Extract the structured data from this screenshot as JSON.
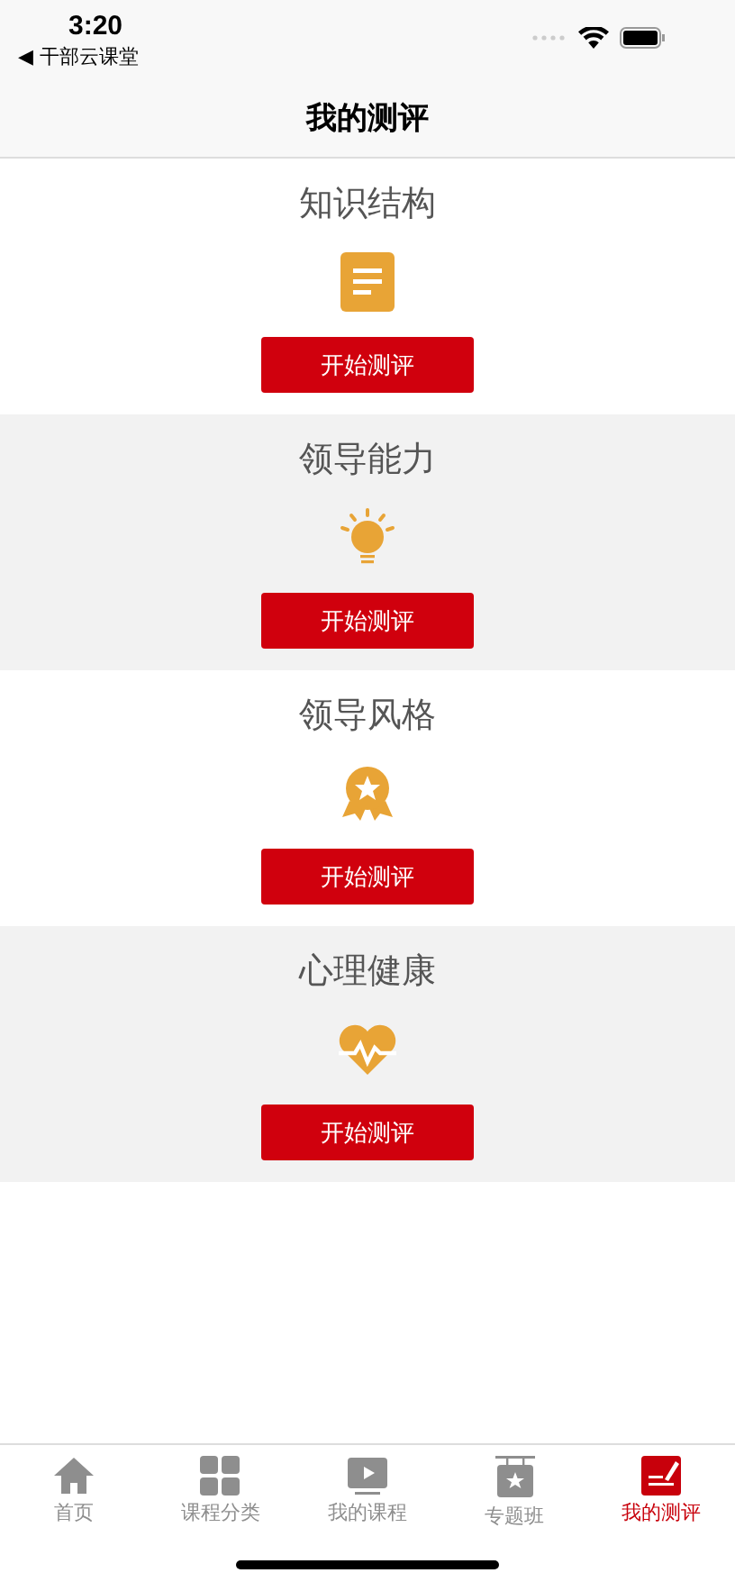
{
  "status_bar": {
    "time": "3:20",
    "back_app": "◀ 干部云课堂"
  },
  "header": {
    "title": "我的测评"
  },
  "sections": [
    {
      "title": "知识结构",
      "kind": "document",
      "button": "开始测评"
    },
    {
      "title": "领导能力",
      "kind": "bulb",
      "button": "开始测评"
    },
    {
      "title": "领导风格",
      "kind": "medal",
      "button": "开始测评"
    },
    {
      "title": "心理健康",
      "kind": "heart",
      "button": "开始测评"
    }
  ],
  "tabs": [
    {
      "label": "首页",
      "kind": "home",
      "selected": false
    },
    {
      "label": "课程分类",
      "kind": "grid",
      "selected": false
    },
    {
      "label": "我的课程",
      "kind": "play",
      "selected": false
    },
    {
      "label": "专题班",
      "kind": "sign",
      "selected": false
    },
    {
      "label": "我的测评",
      "kind": "pen",
      "selected": true
    }
  ]
}
